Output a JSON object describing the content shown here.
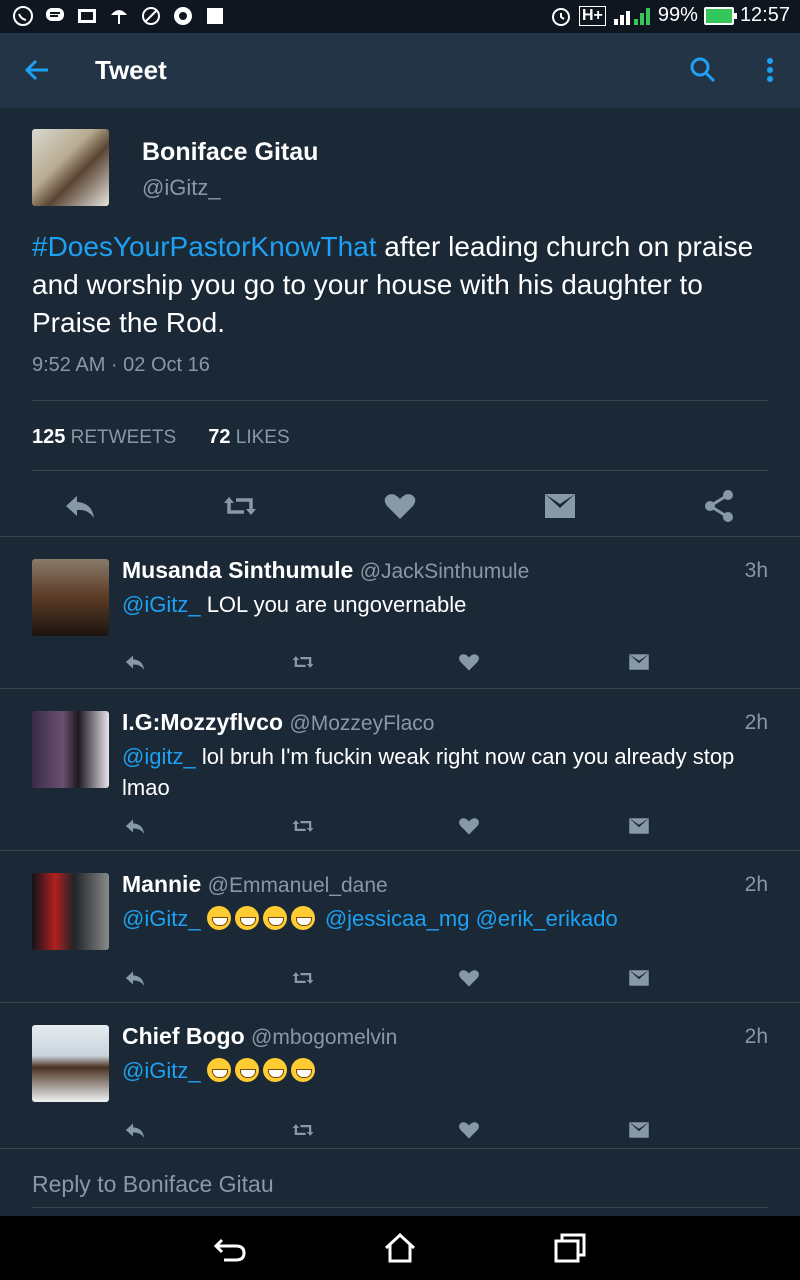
{
  "status_bar": {
    "battery": "99%",
    "time": "12:57",
    "network": "H+"
  },
  "app_bar": {
    "title": "Tweet"
  },
  "tweet": {
    "name": "Boniface Gitau",
    "handle": "@iGitz_",
    "hashtag": "#DoesYourPastorKnowThat",
    "text": " after leading church on praise and worship you go to your house with his daughter to Praise the Rod.",
    "timestamp": "9:52 AM · 02 Oct 16",
    "retweets_count": "125",
    "retweets_label": "RETWEETS",
    "likes_count": "72",
    "likes_label": "LIKES"
  },
  "replies": [
    {
      "name": "Musanda Sinthumule",
      "handle": "@JackSinthumule",
      "time": "3h",
      "mention": "@iGitz_",
      "text": "  LOL you are ungovernable",
      "avatar_color": "#5a3a24"
    },
    {
      "name": "I.G:Mozzyflvco",
      "handle": "@MozzeyFlaco",
      "time": "2h",
      "mention": "@igitz_",
      "text": "  lol bruh I'm fuckin weak right now can you already stop lmao",
      "avatar_color": "#3a2a4a"
    },
    {
      "name": "Mannie",
      "handle": "@Emmanuel_dane",
      "time": "2h",
      "mention": "@iGitz_",
      "mention2": "@jessicaa_mg",
      "mention3": "@erik_erikado",
      "emoji_count": 4,
      "avatar_color": "#1a1a1a"
    },
    {
      "name": "Chief Bogo",
      "handle": "@mbogomelvin",
      "time": "2h",
      "mention": "@iGitz_",
      "emoji_count": 4,
      "avatar_color": "#c8d4dc"
    }
  ],
  "composer": {
    "placeholder": "Reply to Boniface Gitau"
  },
  "colors": {
    "accent": "#1da1f2",
    "background": "#1b2836",
    "appbar": "#243447",
    "secondary_text": "#8899a6"
  }
}
